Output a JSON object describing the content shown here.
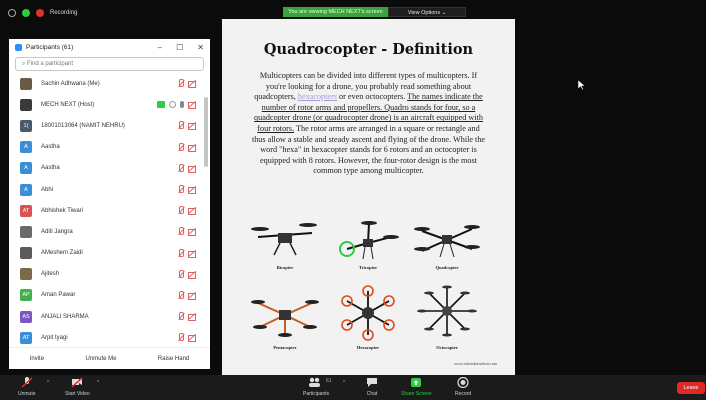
{
  "topbar": {
    "recording_label": "Recording",
    "viewing_banner": "You are viewing MECH NEXT's screen",
    "view_options": "View Options"
  },
  "participants": {
    "title": "Participants (61)",
    "search_placeholder": "Find a participant",
    "items": [
      {
        "avatar": "",
        "avatar_color": "#6b5a48",
        "name": "Sachin Adhwana (Me)",
        "status": "muted"
      },
      {
        "avatar": "",
        "avatar_color": "#3a3a3a",
        "name": "MECH NEXT (Host)",
        "status": "host"
      },
      {
        "avatar": "1(",
        "avatar_color": "#4a5a6a",
        "name": "18001013064 (NAMIT NEHRU)",
        "status": "muted"
      },
      {
        "avatar": "A",
        "avatar_color": "#3b8fd6",
        "name": "Aastha",
        "status": "muted"
      },
      {
        "avatar": "A",
        "avatar_color": "#3b8fd6",
        "name": "Aastha",
        "status": "muted"
      },
      {
        "avatar": "A",
        "avatar_color": "#3b8fd6",
        "name": "Abhi",
        "status": "muted"
      },
      {
        "avatar": "AT",
        "avatar_color": "#d9534f",
        "name": "Abhishek Tiwari",
        "status": "muted"
      },
      {
        "avatar": "",
        "avatar_color": "#6a6a6a",
        "name": "Aditi Jangra",
        "status": "muted"
      },
      {
        "avatar": "",
        "avatar_color": "#5a5a5a",
        "name": "AMeshem Zaidi",
        "status": "muted"
      },
      {
        "avatar": "",
        "avatar_color": "#7a6a4a",
        "name": "Ajitesh",
        "status": "muted"
      },
      {
        "avatar": "AP",
        "avatar_color": "#3fb04a",
        "name": "Aman Pawar",
        "status": "muted"
      },
      {
        "avatar": "AS",
        "avatar_color": "#7b55c4",
        "name": "ANJALI SHARMA",
        "status": "muted"
      },
      {
        "avatar": "AT",
        "avatar_color": "#3b8fd6",
        "name": "Arpit tyagi",
        "status": "muted"
      }
    ],
    "footer": {
      "invite": "Invite",
      "unmute_me": "Unmute Me",
      "raise_hand": "Raise Hand"
    }
  },
  "document": {
    "title": "Quadrocopter - Definition",
    "p1": "Multicopters can be divided into different types of multicopters. If you're looking for a drone, you probably read something about quadcopters,",
    "p1_link": "hexacopters",
    "p1_tail": "or even octocopters.",
    "p2_underlined": "The names indicate the number of rotor arms and propellers. Quadro stands for four, so a quadcopter drone (or quadrocopter drone) is an aircraft equipped with four rotors.",
    "p3": "The rotor arms are arranged in a square or rectangle and thus allow a stable and steady ascent and flying of the drone. While the word \"hexa\" in hexacopter stands for 6 rotors and an octocopter is equipped with 8 rotors. However, the four-rotor design is the most common type among multicopter.",
    "labels": [
      "Bicopter",
      "Tricopter",
      "Quadcopter",
      "Pentacopter",
      "Hexacopter",
      "Octocopter"
    ],
    "copyright": "www.robotsknowhow.com"
  },
  "toolbar": {
    "unmute": "Unmute",
    "start_video": "Start Video",
    "participants": "Participants",
    "participants_count": "61",
    "chat": "Chat",
    "share_screen": "Share Screen",
    "record": "Record",
    "leave": "Leave"
  },
  "colors": {
    "host_accent": "#2ecc40",
    "leave": "#e02828",
    "share_screen": "#2ecc40",
    "banner": "#3aa33a"
  }
}
